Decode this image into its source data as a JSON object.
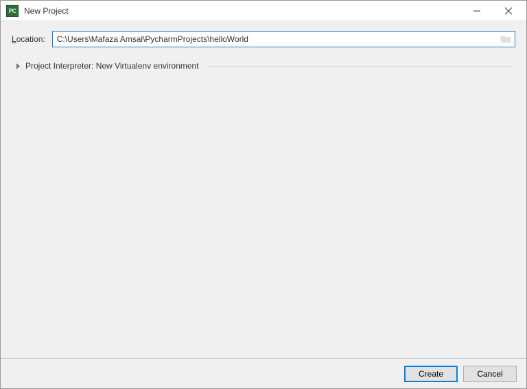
{
  "window": {
    "title": "New Project"
  },
  "location": {
    "label_prefix": "L",
    "label_rest": "ocation:",
    "value": "C:\\Users\\Mafaza Amsal\\PycharmProjects\\helloWorld"
  },
  "interpreter": {
    "label": "Project Interpreter: New Virtualenv environment"
  },
  "buttons": {
    "create": "Create",
    "cancel": "Cancel"
  }
}
